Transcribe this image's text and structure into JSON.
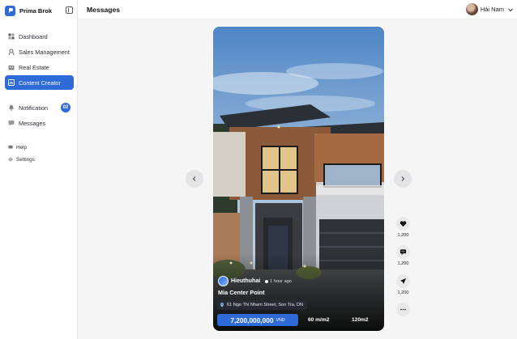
{
  "app": {
    "name": "Prima Brok"
  },
  "header": {
    "title": "Messages",
    "user_name": "Hải Nam"
  },
  "sidebar": {
    "items": [
      {
        "label": "Dashboard",
        "icon": "dashboard-icon"
      },
      {
        "label": "Sales Management",
        "icon": "sales-icon"
      },
      {
        "label": "Real Estate",
        "icon": "building-icon"
      },
      {
        "label": "Content Creator",
        "icon": "content-icon",
        "active": true
      },
      {
        "label": "Notification",
        "icon": "bell-icon",
        "badge": "02"
      },
      {
        "label": "Messages",
        "icon": "message-icon"
      },
      {
        "label": "Help",
        "icon": "help-icon"
      },
      {
        "label": "Settings",
        "icon": "gear-icon"
      }
    ]
  },
  "post": {
    "author": "Hieuthuhai",
    "time": "1 hour ago",
    "title": "Mia Center Point",
    "address": "61 Ngo Thi Nham Street, Son Tra, DN",
    "price": "7,200,000,000",
    "currency": "VND",
    "price_per_area": "60 m/m2",
    "area": "120m2"
  },
  "actions": {
    "likes": "1,200",
    "comments": "1,200",
    "shares": "1,200"
  },
  "colors": {
    "accent": "#2f6bd8",
    "sidebar_bg": "#ffffff",
    "main_bg": "#f5f5f6"
  }
}
